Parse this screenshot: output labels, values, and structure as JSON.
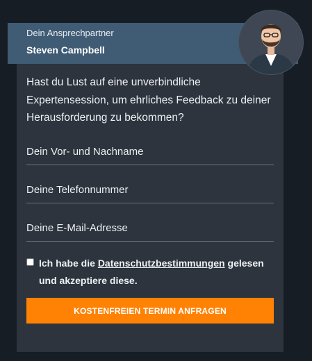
{
  "contact": {
    "role": "Dein Ansprechpartner",
    "name": "Steven Campbell"
  },
  "intro": "Hast du Lust auf eine unverbindliche Expertensession, um ehrliches Feedback zu deiner Herausforderung zu bekommen?",
  "form": {
    "name_placeholder": "Dein Vor- und Nachname",
    "phone_placeholder": "Deine Telefonnummer",
    "email_placeholder": "Deine E-Mail-Adresse",
    "consent": {
      "checked": false,
      "prefix": "Ich habe die ",
      "link_text": "Datenschutzbestimmungen",
      "suffix": " gelesen und akzeptiere diese."
    },
    "submit_label": "KOSTENFREIEN TERMIN ANFRAGEN"
  },
  "colors": {
    "accent": "#ff8204",
    "header": "#405c75",
    "card": "#2d343d",
    "background": "#171d25"
  }
}
